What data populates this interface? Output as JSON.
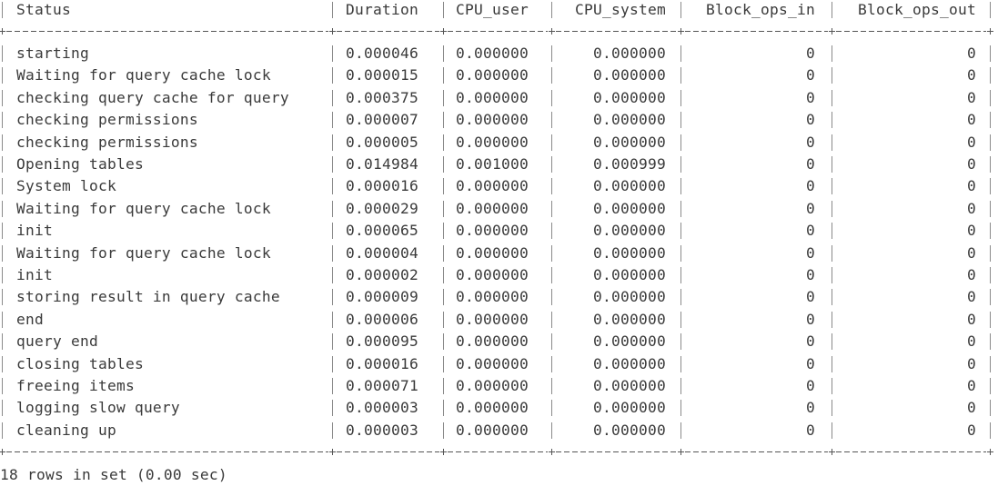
{
  "terminal": {
    "table": {
      "columns": [
        "Status",
        "Duration",
        "CPU_user",
        "CPU_system",
        "Block_ops_in",
        "Block_ops_out"
      ],
      "rows": [
        [
          "starting",
          "0.000046",
          "0.000000",
          "0.000000",
          "0",
          "0"
        ],
        [
          "Waiting for query cache lock",
          "0.000015",
          "0.000000",
          "0.000000",
          "0",
          "0"
        ],
        [
          "checking query cache for query",
          "0.000375",
          "0.000000",
          "0.000000",
          "0",
          "0"
        ],
        [
          "checking permissions",
          "0.000007",
          "0.000000",
          "0.000000",
          "0",
          "0"
        ],
        [
          "checking permissions",
          "0.000005",
          "0.000000",
          "0.000000",
          "0",
          "0"
        ],
        [
          "Opening tables",
          "0.014984",
          "0.001000",
          "0.000999",
          "0",
          "0"
        ],
        [
          "System lock",
          "0.000016",
          "0.000000",
          "0.000000",
          "0",
          "0"
        ],
        [
          "Waiting for query cache lock",
          "0.000029",
          "0.000000",
          "0.000000",
          "0",
          "0"
        ],
        [
          "init",
          "0.000065",
          "0.000000",
          "0.000000",
          "0",
          "0"
        ],
        [
          "Waiting for query cache lock",
          "0.000004",
          "0.000000",
          "0.000000",
          "0",
          "0"
        ],
        [
          "init",
          "0.000002",
          "0.000000",
          "0.000000",
          "0",
          "0"
        ],
        [
          "storing result in query cache",
          "0.000009",
          "0.000000",
          "0.000000",
          "0",
          "0"
        ],
        [
          "end",
          "0.000006",
          "0.000000",
          "0.000000",
          "0",
          "0"
        ],
        [
          "query end",
          "0.000095",
          "0.000000",
          "0.000000",
          "0",
          "0"
        ],
        [
          "closing tables",
          "0.000016",
          "0.000000",
          "0.000000",
          "0",
          "0"
        ],
        [
          "freeing items",
          "0.000071",
          "0.000000",
          "0.000000",
          "0",
          "0"
        ],
        [
          "logging slow query",
          "0.000003",
          "0.000000",
          "0.000000",
          "0",
          "0"
        ],
        [
          "cleaning up",
          "0.000003",
          "0.000000",
          "0.000000",
          "0",
          "0"
        ]
      ]
    },
    "footer": "18 rows in set (0.00 sec)"
  }
}
